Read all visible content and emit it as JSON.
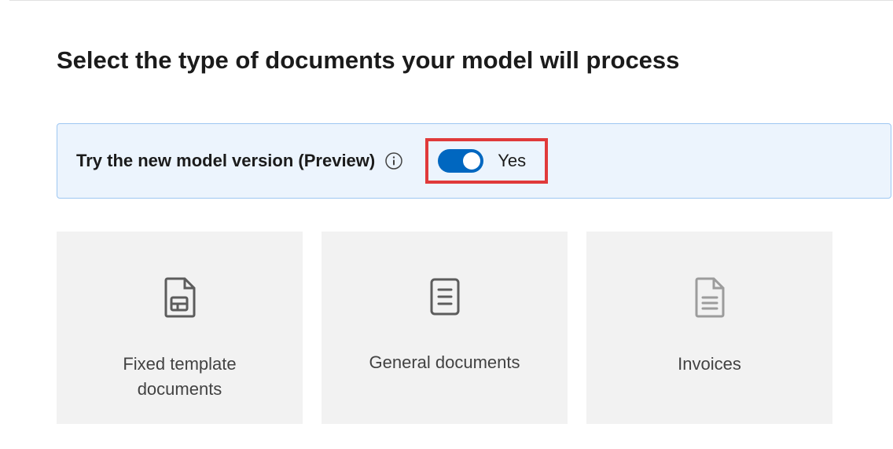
{
  "page": {
    "title": "Select the type of documents your model will process"
  },
  "previewBanner": {
    "label": "Try the new model version (Preview)",
    "toggleState": "Yes"
  },
  "cards": [
    {
      "label": "Fixed template documents"
    },
    {
      "label": "General documents"
    },
    {
      "label": "Invoices"
    }
  ]
}
